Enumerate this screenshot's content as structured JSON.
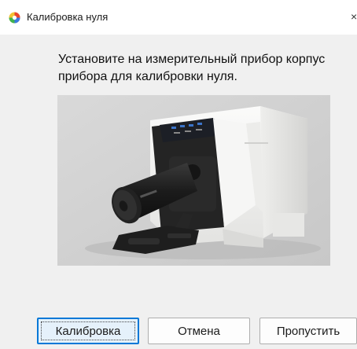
{
  "window": {
    "title": "Калибровка нуля",
    "icon": "color-wheel-icon",
    "close_icon": "close-icon",
    "close_glyph": "×"
  },
  "instruction": "Установите на измерительный прибор корпус прибора для калибровки нуля.",
  "image": {
    "subject": "measuring-instrument-photo"
  },
  "buttons": {
    "calibrate": "Калибровка",
    "cancel": "Отмена",
    "skip": "Пропустить"
  },
  "colors": {
    "dialog_bg": "#f0f0f0",
    "titlebar_bg": "#ffffff",
    "primary_border": "#0078d7",
    "device_body": "#f4f4f2",
    "device_dark": "#222222"
  }
}
